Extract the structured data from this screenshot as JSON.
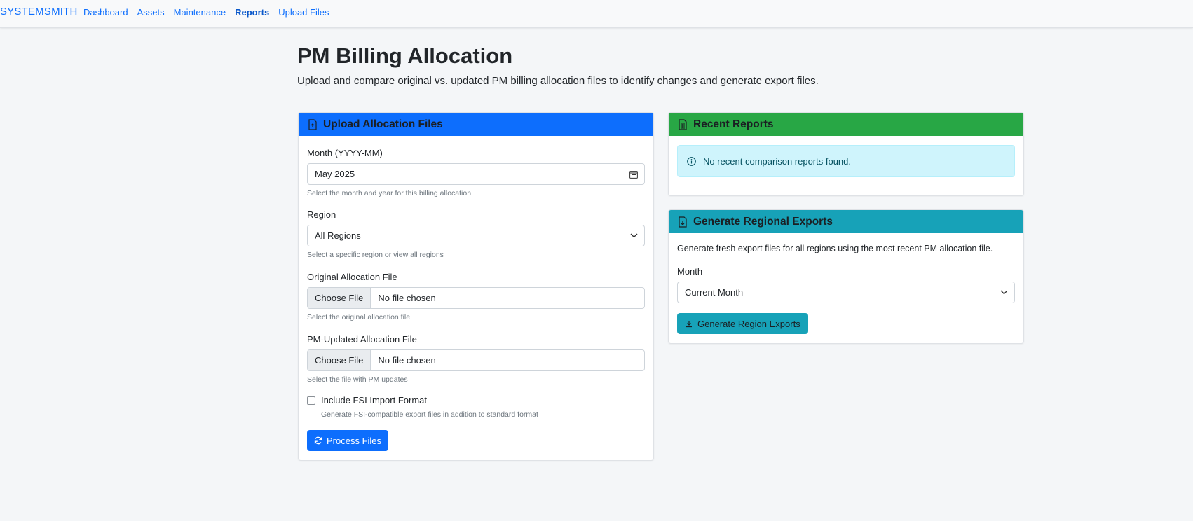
{
  "navbar": {
    "brand": "SYSTEMSMITH",
    "links": [
      "Dashboard",
      "Assets",
      "Maintenance",
      "Reports",
      "Upload Files"
    ],
    "active": "Reports"
  },
  "header": {
    "title": "PM Billing Allocation",
    "subtitle": "Upload and compare original vs. updated PM billing allocation files to identify changes and generate export files."
  },
  "upload_card": {
    "title": "Upload Allocation Files",
    "icon": "file-upload-icon",
    "month_label": "Month (YYYY-MM)",
    "month_value": "May 2025",
    "month_help": "Select the month and year for this billing allocation",
    "region_label": "Region",
    "region_value": "All Regions",
    "region_help": "Select a specific region or view all regions",
    "original_label": "Original Allocation File",
    "original_button": "Choose File",
    "original_status": "No file chosen",
    "original_help": "Select the original allocation file",
    "updated_label": "PM-Updated Allocation File",
    "updated_button": "Choose File",
    "updated_status": "No file chosen",
    "updated_help": "Select the file with PM updates",
    "fsi_label": "Include FSI Import Format",
    "fsi_help": "Generate FSI-compatible export files in addition to standard format",
    "fsi_checked": false,
    "process_button": "Process Files"
  },
  "recent_card": {
    "title": "Recent Reports",
    "icon": "spreadsheet-icon",
    "alert": "No recent comparison reports found."
  },
  "export_card": {
    "title": "Generate Regional Exports",
    "icon": "file-export-icon",
    "description": "Generate fresh export files for all regions using the most recent PM allocation file.",
    "month_label": "Month",
    "month_value": "Current Month",
    "button": "Generate Region Exports"
  },
  "colors": {
    "primary": "#0d6efd",
    "success": "#28a745",
    "info": "#17a2b8",
    "alert_bg": "#cff4fc"
  }
}
